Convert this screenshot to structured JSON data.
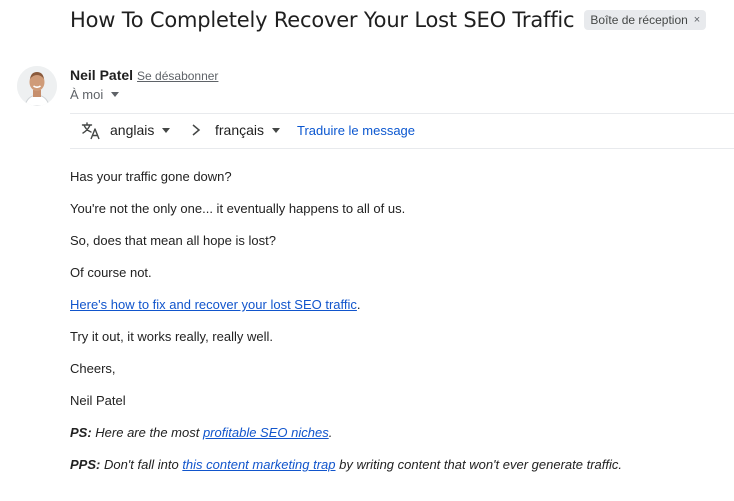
{
  "email": {
    "subject": "How To Completely Recover Your Lost SEO Traffic",
    "label": "Boîte de réception",
    "label_close": "×",
    "sender": {
      "name": "Neil Patel",
      "unsubscribe": "Se désabonner"
    },
    "recipient": "À moi"
  },
  "translate_bar": {
    "icon": "translate-icon",
    "source_lang": "anglais",
    "target_lang": "français",
    "action": "Traduire le message"
  },
  "body": {
    "p1": "Has your traffic gone down?",
    "p2": "You're not the only one... it eventually happens to all of us.",
    "p3": "So, does that mean all hope is lost?",
    "p4": "Of course not.",
    "p5_link": "Here's how to fix and recover your lost SEO traffic",
    "p5_tail": ".",
    "p6": "Try it out, it works really, really well.",
    "p7": "Cheers,",
    "p8": "Neil Patel",
    "ps_label": "PS:",
    "ps_text": " Here are the most ",
    "ps_link": "profitable SEO niches",
    "ps_tail": ".",
    "pps_label": "PPS:",
    "pps_text": " Don't fall into ",
    "pps_link": "this content marketing trap",
    "pps_tail": " by writing content that won't ever generate traffic."
  },
  "colors": {
    "link": "#1155cc",
    "translate_link": "#0b57d0",
    "chip_bg": "#e8eaed"
  }
}
